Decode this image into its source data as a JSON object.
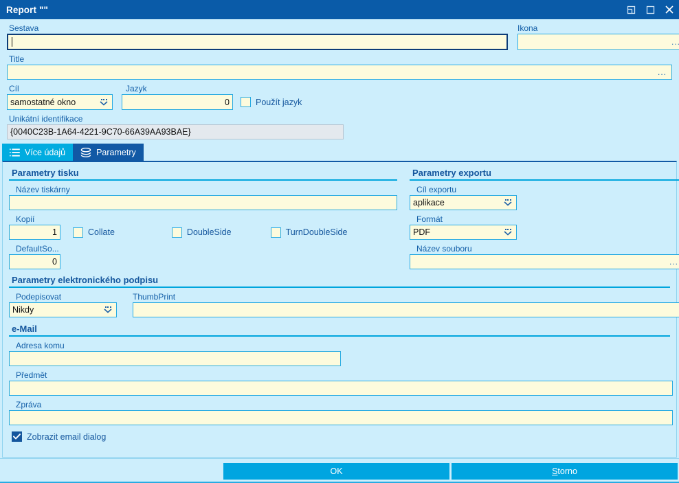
{
  "window": {
    "title": "Report \"\"",
    "buttons": {
      "restore": "restore-window",
      "maximize": "maximize-window",
      "close": "close-window"
    }
  },
  "header": {
    "sestava": {
      "label": "Sestava",
      "value": "",
      "focused": true
    },
    "ikona": {
      "label": "Ikona",
      "value": "",
      "ellipsis": "..."
    },
    "title": {
      "label": "Title",
      "value": "",
      "ellipsis": "..."
    },
    "cil": {
      "label": "Cíl",
      "value": "samostatné okno"
    },
    "jazyk": {
      "label": "Jazyk",
      "value": "0"
    },
    "pouzit_jazyk": {
      "label": "Použít jazyk",
      "checked": false
    },
    "unikatni": {
      "label": "Unikátní identifikace",
      "value": "{0040C23B-1A64-4221-9C70-66A39AA93BAE}"
    }
  },
  "tabs": [
    {
      "label": "Více údajů",
      "icon": "list-icon",
      "active": false
    },
    {
      "label": "Parametry",
      "icon": "layers-icon",
      "active": true
    }
  ],
  "print": {
    "group_title": "Parametry tisku",
    "printer_name": {
      "label": "Název tiskárny",
      "value": ""
    },
    "copies": {
      "label": "Kopií",
      "value": "1"
    },
    "collate": {
      "label": "Collate",
      "checked": false
    },
    "double_side": {
      "label": "DoubleSide",
      "checked": false
    },
    "turn_double_side": {
      "label": "TurnDoubleSide",
      "checked": false
    },
    "default_source": {
      "label": "DefaultSo...",
      "value": "0"
    }
  },
  "export": {
    "group_title": "Parametry exportu",
    "target": {
      "label": "Cíl exportu",
      "value": "aplikace"
    },
    "format": {
      "label": "Formát",
      "value": "PDF"
    },
    "file_name": {
      "label": "Název souboru",
      "value": "",
      "ellipsis": "..."
    }
  },
  "signature": {
    "group_title": "Parametry elektronického podpisu",
    "sign": {
      "label": "Podepisovat",
      "value": "Nikdy"
    },
    "thumbprint": {
      "label": "ThumbPrint",
      "value": ""
    }
  },
  "email": {
    "group_title": "e-Mail",
    "to": {
      "label": "Adresa komu",
      "value": ""
    },
    "subject": {
      "label": "Předmět",
      "value": ""
    },
    "message": {
      "label": "Zpráva",
      "value": ""
    },
    "show_dialog": {
      "label": "Zobrazit email dialog",
      "checked": true
    }
  },
  "footer": {
    "ok": "OK",
    "cancel_accel": "S",
    "cancel_rest": "torno"
  },
  "colors": {
    "titlebar": "#0a5ba8",
    "background": "#cdeefc",
    "field": "#fdfbdd",
    "field_border": "#29abe2",
    "accent": "#00a5e0",
    "label": "#135fa8",
    "tab_active": "#1159a5",
    "tab_inactive": "#00ace0"
  }
}
